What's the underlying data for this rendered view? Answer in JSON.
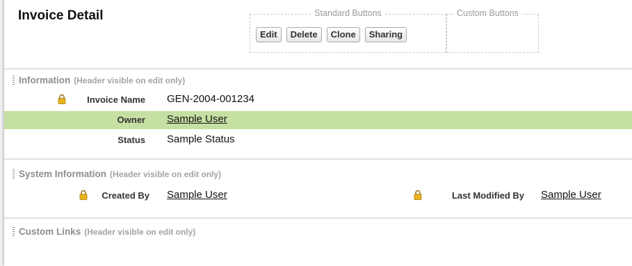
{
  "header": {
    "title": "Invoice Detail",
    "standard_group_label": "Standard Buttons",
    "custom_group_label": "Custom Buttons",
    "buttons": [
      "Edit",
      "Delete",
      "Clone",
      "Sharing"
    ]
  },
  "sections": {
    "information": {
      "title": "Information",
      "note": "(Header visible on edit only)",
      "fields": {
        "invoice_name": {
          "label": "Invoice Name",
          "value": "GEN-2004-001234"
        },
        "owner": {
          "label": "Owner",
          "value": "Sample User"
        },
        "status": {
          "label": "Status",
          "value": "Sample Status"
        }
      }
    },
    "system": {
      "title": "System Information",
      "note": "(Header visible on edit only)",
      "fields": {
        "created_by": {
          "label": "Created By",
          "value": "Sample User"
        },
        "last_modified_by": {
          "label": "Last Modified By",
          "value": "Sample User"
        }
      }
    },
    "custom_links": {
      "title": "Custom Links",
      "note": "(Header visible on edit only)"
    }
  },
  "colors": {
    "highlight_row": "#c6dfa3",
    "lock_icon": "#e8b31e",
    "section_header": "#8e8e8e"
  },
  "icons": {
    "required": "lock-icon"
  }
}
